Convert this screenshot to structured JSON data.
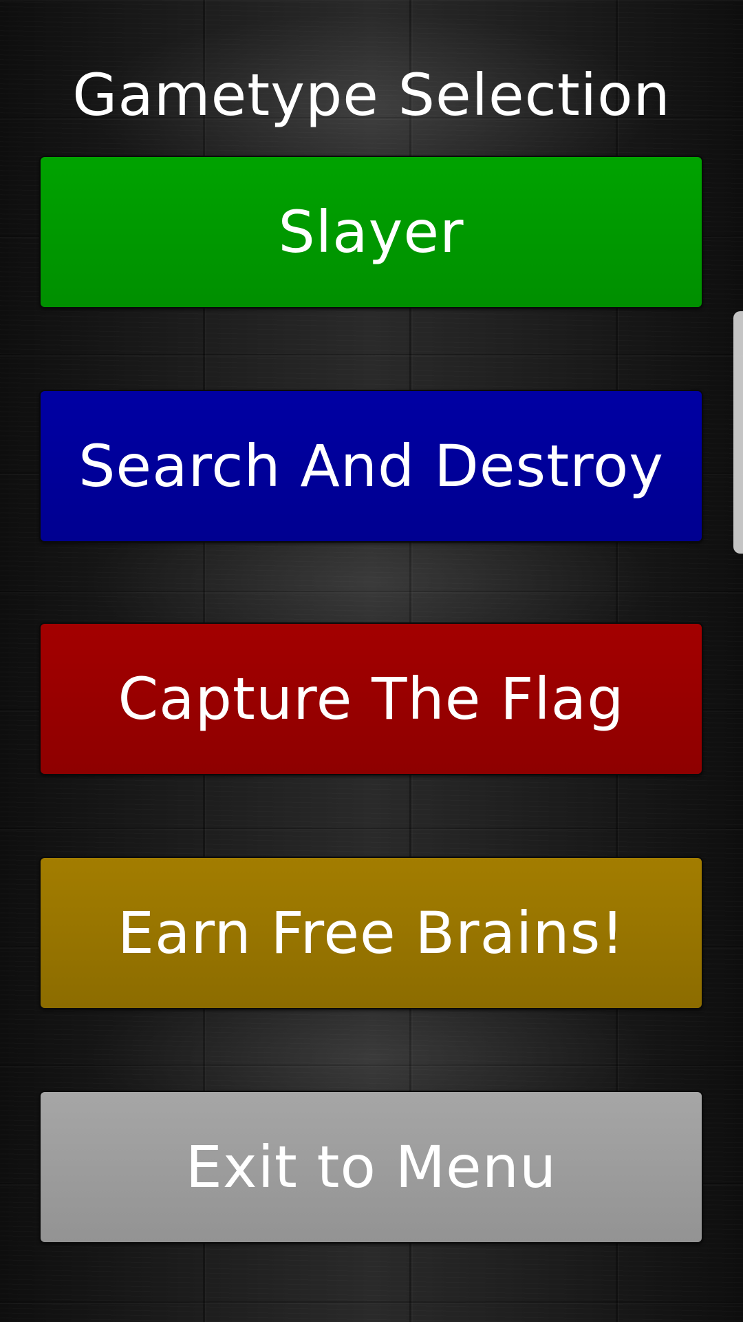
{
  "screen": {
    "title": "Gametype Selection"
  },
  "buttons": {
    "slayer": "Slayer",
    "search_and_destroy": "Search And Destroy",
    "capture_the_flag": "Capture The Flag",
    "earn_free_brains": "Earn Free Brains!",
    "exit_to_menu": "Exit to Menu"
  },
  "colors": {
    "slayer": "#00a300",
    "search_and_destroy": "#0000a3",
    "capture_the_flag": "#a30000",
    "earn_free_brains": "#a37d00",
    "exit_to_menu": "#a6a6a6",
    "background": "#1b1b1b"
  }
}
